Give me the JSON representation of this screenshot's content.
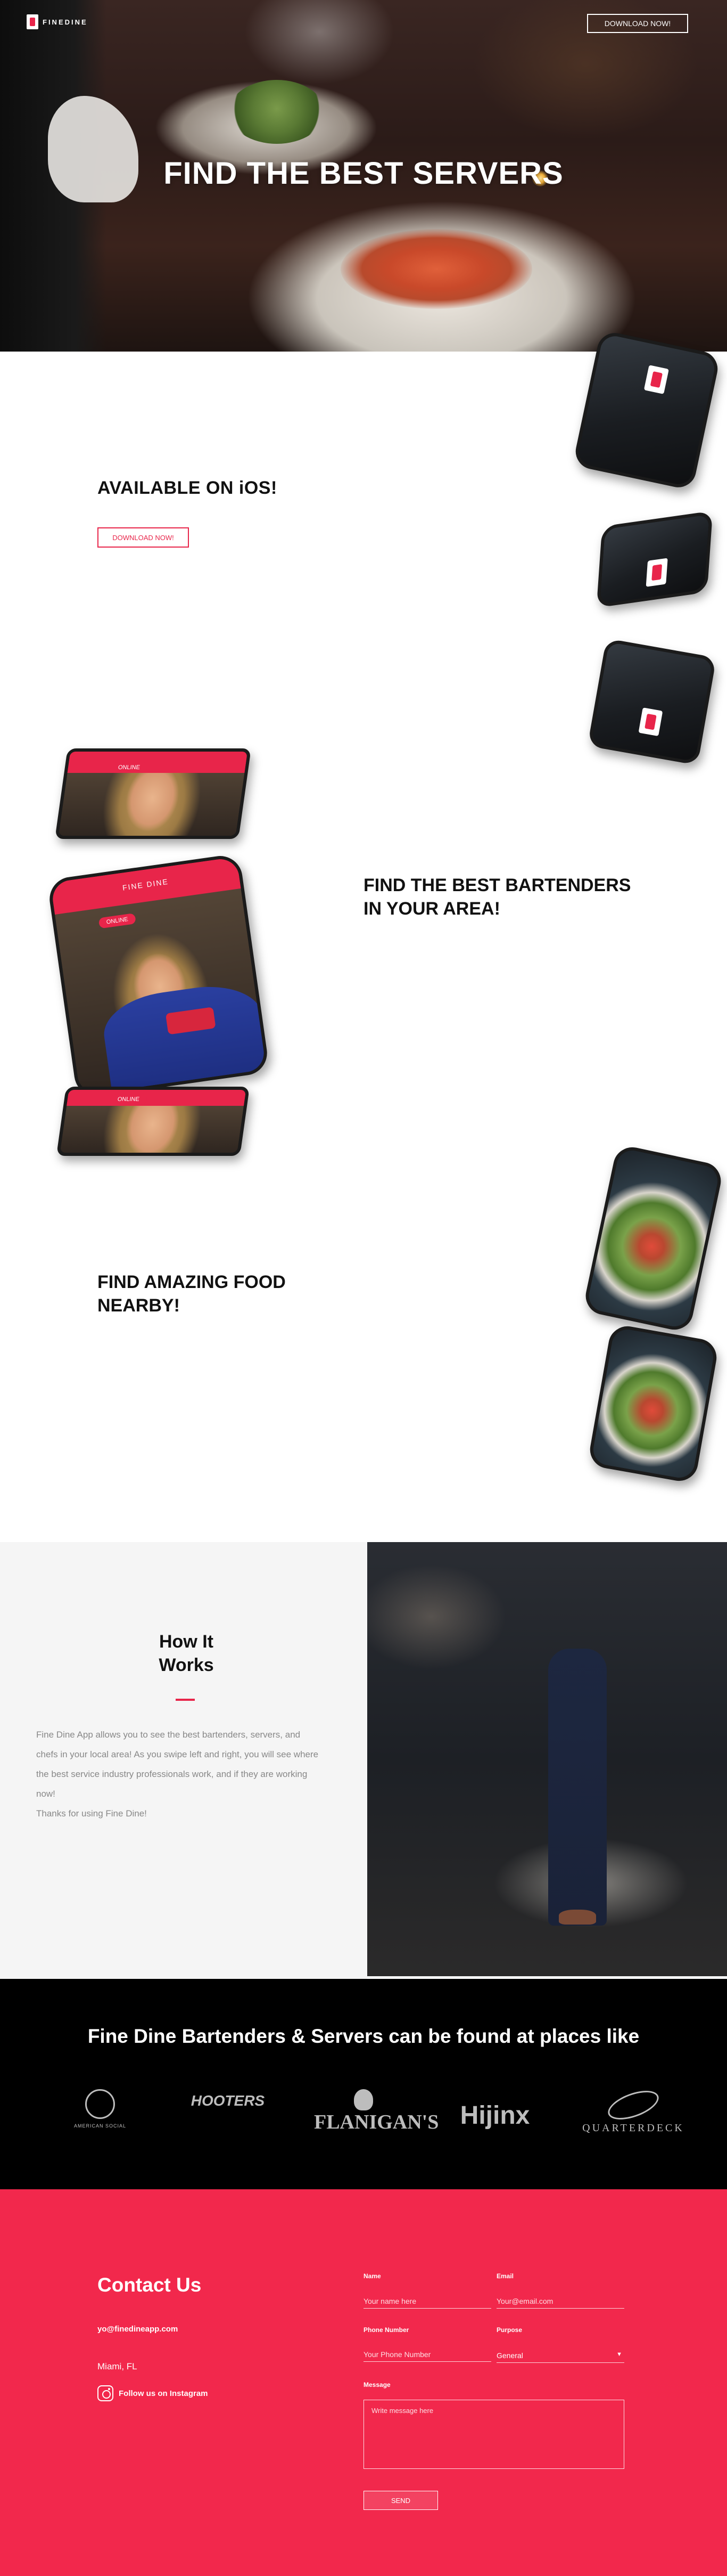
{
  "header": {
    "logo_text": "FINEDINE",
    "download_button": "DOWNLOAD NOW!"
  },
  "hero": {
    "title": "FIND THE BEST SERVERS"
  },
  "section_ios": {
    "title": "AVAILABLE ON iOS!",
    "button": "DOWNLOAD NOW!"
  },
  "section_bartenders": {
    "title_line1": "FIND THE BEST BARTENDERS",
    "title_line2": "IN YOUR AREA!",
    "phone_header": "FINE DINE",
    "online_badge": "ONLINE"
  },
  "section_food": {
    "title_line1": "FIND AMAZING FOOD",
    "title_line2": "NEARBY!"
  },
  "how": {
    "title_line1": "How It",
    "title_line2": "Works",
    "text": "Fine Dine App allows you to see the best bartenders, servers, and chefs in your local area! As you swipe left and right, you will see where the best service industry professionals work, and if they are working now!",
    "thanks": "Thanks for using Fine Dine!"
  },
  "brands": {
    "title": "Fine Dine Bartenders & Servers can be found at places like",
    "items": [
      {
        "name": "AMERICAN SOCIAL",
        "icon": "american-social-logo"
      },
      {
        "name": "HOOTERS",
        "icon": "hooters-logo"
      },
      {
        "name": "FLANIGAN'S",
        "icon": "flanigans-logo"
      },
      {
        "name": "Hijinx",
        "icon": "hijinx-logo"
      },
      {
        "name": "QUARTERDECK",
        "icon": "quarterdeck-logo"
      }
    ]
  },
  "contact": {
    "title": "Contact Us",
    "email": "yo@finedineapp.com",
    "city": "Miami, FL",
    "instagram": "Follow us on Instagram",
    "form": {
      "name_label": "Name",
      "name_placeholder": "Your name here",
      "email_label": "Email",
      "email_placeholder": "Your@email.com",
      "phone_label": "Phone Number",
      "phone_placeholder": "Your Phone Number",
      "purpose_label": "Purpose",
      "purpose_value": "General",
      "message_label": "Message",
      "message_placeholder": "Write message here",
      "send": "SEND"
    }
  },
  "colors": {
    "accent": "#e8254a",
    "contact_bg": "#f2284c",
    "brands_bg": "#000000"
  }
}
